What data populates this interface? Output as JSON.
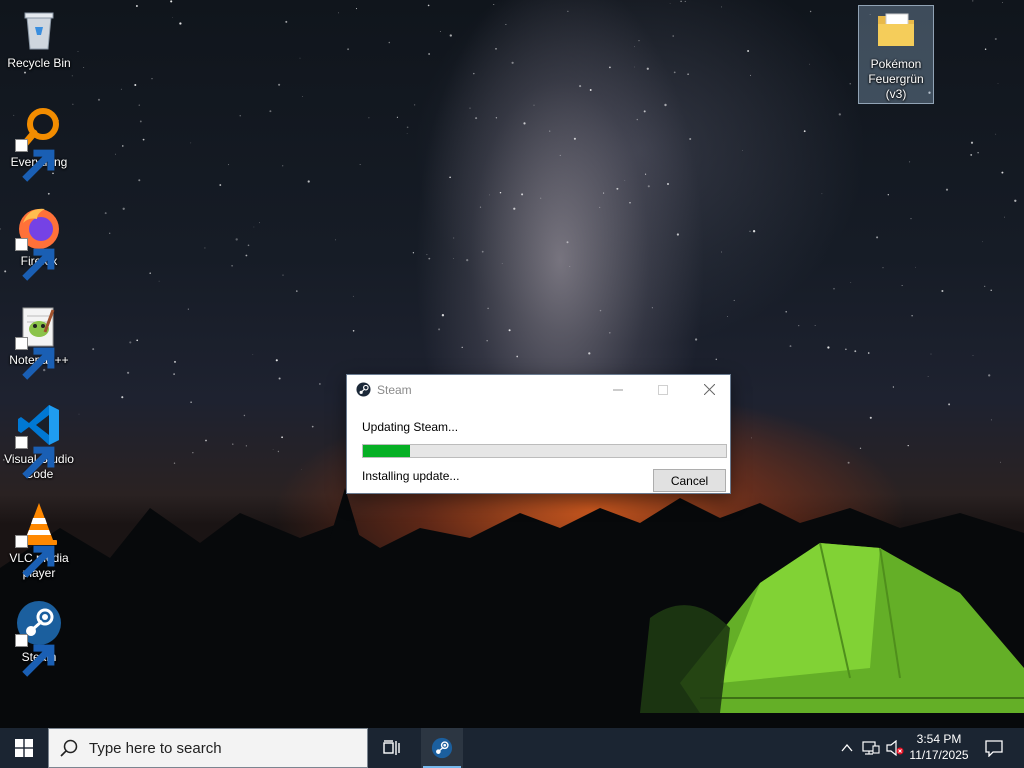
{
  "desktop": {
    "icons": [
      {
        "label": "Recycle Bin",
        "icon": "recycle-bin-icon"
      },
      {
        "label": "Everything",
        "icon": "everything-search-icon"
      },
      {
        "label": "Firefox",
        "icon": "firefox-icon"
      },
      {
        "label": "Notepad++",
        "icon": "notepad-plus-plus-icon"
      },
      {
        "label": "Visual Studio Code",
        "icon": "vscode-icon"
      },
      {
        "label": "VLC media player",
        "icon": "vlc-icon"
      },
      {
        "label": "Steam",
        "icon": "steam-icon"
      },
      {
        "label": "Pokémon Feuergrün (v3)",
        "icon": "folder-icon"
      }
    ]
  },
  "dialog": {
    "title": "Steam",
    "heading": "Updating Steam...",
    "status": "Installing update...",
    "cancel_label": "Cancel",
    "progress": 0.13,
    "progress_color": "#06b025"
  },
  "taskbar": {
    "search_placeholder": "Type here to search",
    "clock_time": "3:54 PM",
    "clock_date": "11/17/2025",
    "accent": "#76b9ed"
  }
}
